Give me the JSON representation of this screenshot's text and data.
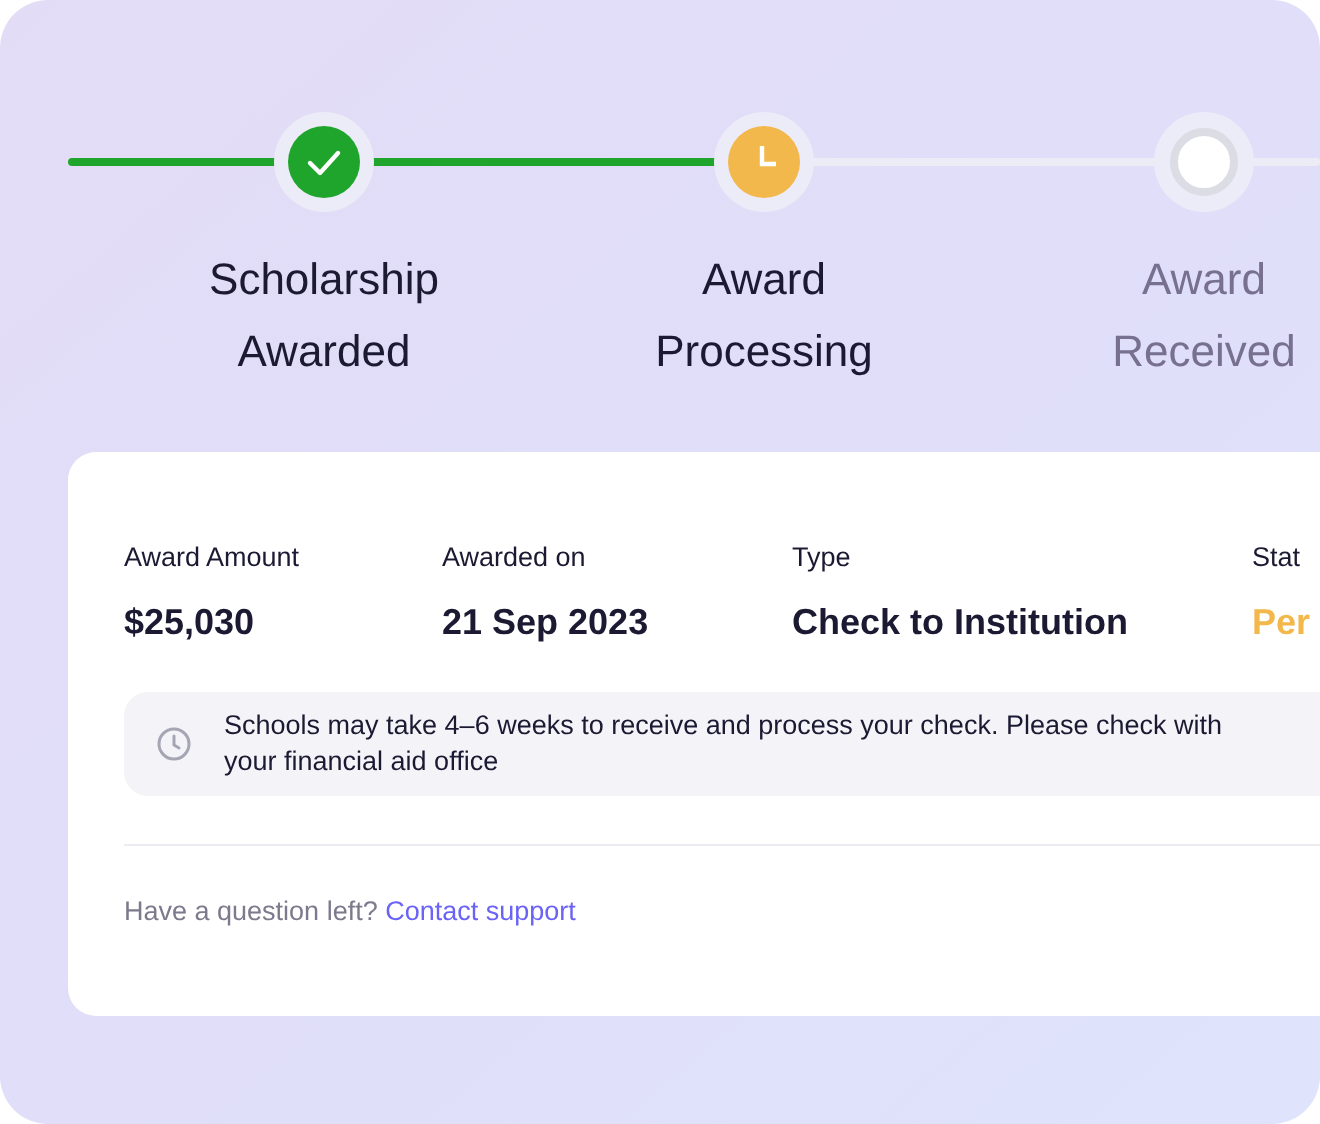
{
  "steps": [
    {
      "label": "Scholarship Awarded",
      "kind": "done"
    },
    {
      "label": "Award Processing",
      "kind": "current"
    },
    {
      "label": "Award Received",
      "kind": "pending"
    }
  ],
  "details": [
    {
      "label": "Award Amount",
      "value": "$25,030",
      "kind": "plain"
    },
    {
      "label": "Awarded on",
      "value": "21 Sep 2023",
      "kind": "plain"
    },
    {
      "label": "Type",
      "value": "Check to Institution",
      "kind": "plain"
    },
    {
      "label": "Stat",
      "value": "Per",
      "kind": "pending"
    }
  ],
  "notice": "Schools may take 4–6 weeks to receive and process your check. Please check with your financial aid office",
  "footer": {
    "text": "Have a question left?",
    "link": "Contact support"
  }
}
